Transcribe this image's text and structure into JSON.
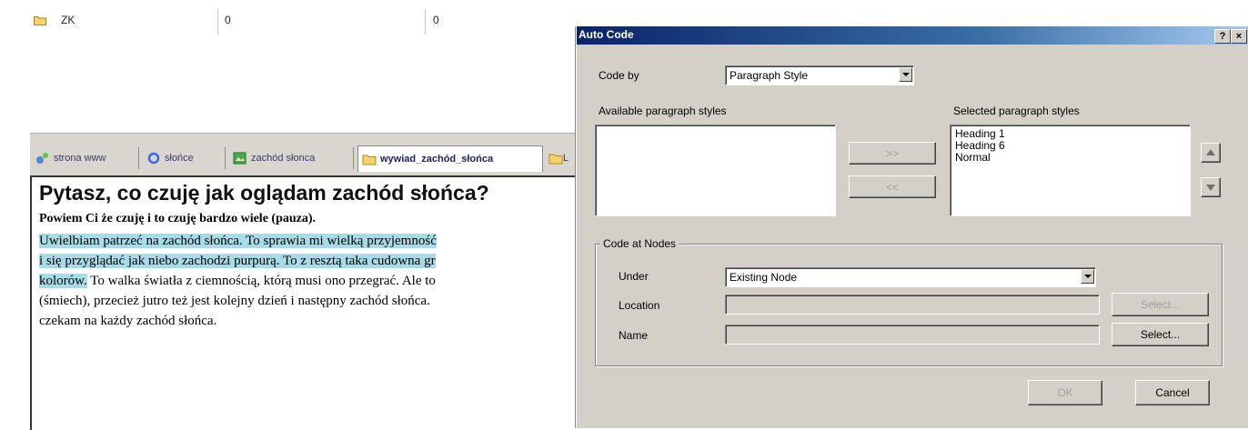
{
  "list": {
    "row": {
      "name": "ZK",
      "col2": "0",
      "col3": "0"
    }
  },
  "tabs": [
    {
      "label": "strona www",
      "icon": "web-link-icon"
    },
    {
      "label": "słońce",
      "icon": "refresh-icon"
    },
    {
      "label": "zachód słonca",
      "icon": "image-icon"
    },
    {
      "label": "wywiad_zachód_słońca",
      "icon": "folder-icon"
    },
    {
      "label": "L",
      "icon": "folder-icon"
    }
  ],
  "document": {
    "heading": "Pytasz, co czuję jak oglądam zachód słońca?",
    "subheading": "Powiem Ci że czuję i to czuję bardzo wiele (pauza).",
    "lines": [
      {
        "text": "Uwielbiam patrzeć na zachód słońca. To sprawia mi wielką przyjemność",
        "highlight": "full"
      },
      {
        "text": "i się przyglądać jak niebo zachodzi purpurą. To z resztą taka cudowna gr",
        "highlight": "full"
      },
      {
        "hl_text": "kolorów.",
        "text": " To walka światła z ciemnością, którą musi ono przegrać. Ale to",
        "highlight": "partial"
      },
      {
        "text": "(śmiech), przecież jutro też jest kolejny dzień i następny zachód słońca.",
        "highlight": "none"
      },
      {
        "text": "czekam na każdy zachód słońca.",
        "highlight": "none"
      }
    ]
  },
  "dialog": {
    "title": "Auto Code",
    "help_button": "?",
    "close_button": "×",
    "code_by_label": "Code by",
    "code_by_value": "Paragraph Style",
    "available_label": "Available paragraph styles",
    "selected_label": "Selected paragraph styles",
    "selected_items": [
      "Heading 1",
      "Heading 6",
      "Normal"
    ],
    "add_button": ">>",
    "remove_button": "<<",
    "group_title": "Code at Nodes",
    "under_label": "Under",
    "under_value": "Existing Node",
    "location_label": "Location",
    "name_label": "Name",
    "select_button_1": "Select...",
    "select_button_2": "Select...",
    "ok_button": "OK",
    "cancel_button": "Cancel"
  }
}
